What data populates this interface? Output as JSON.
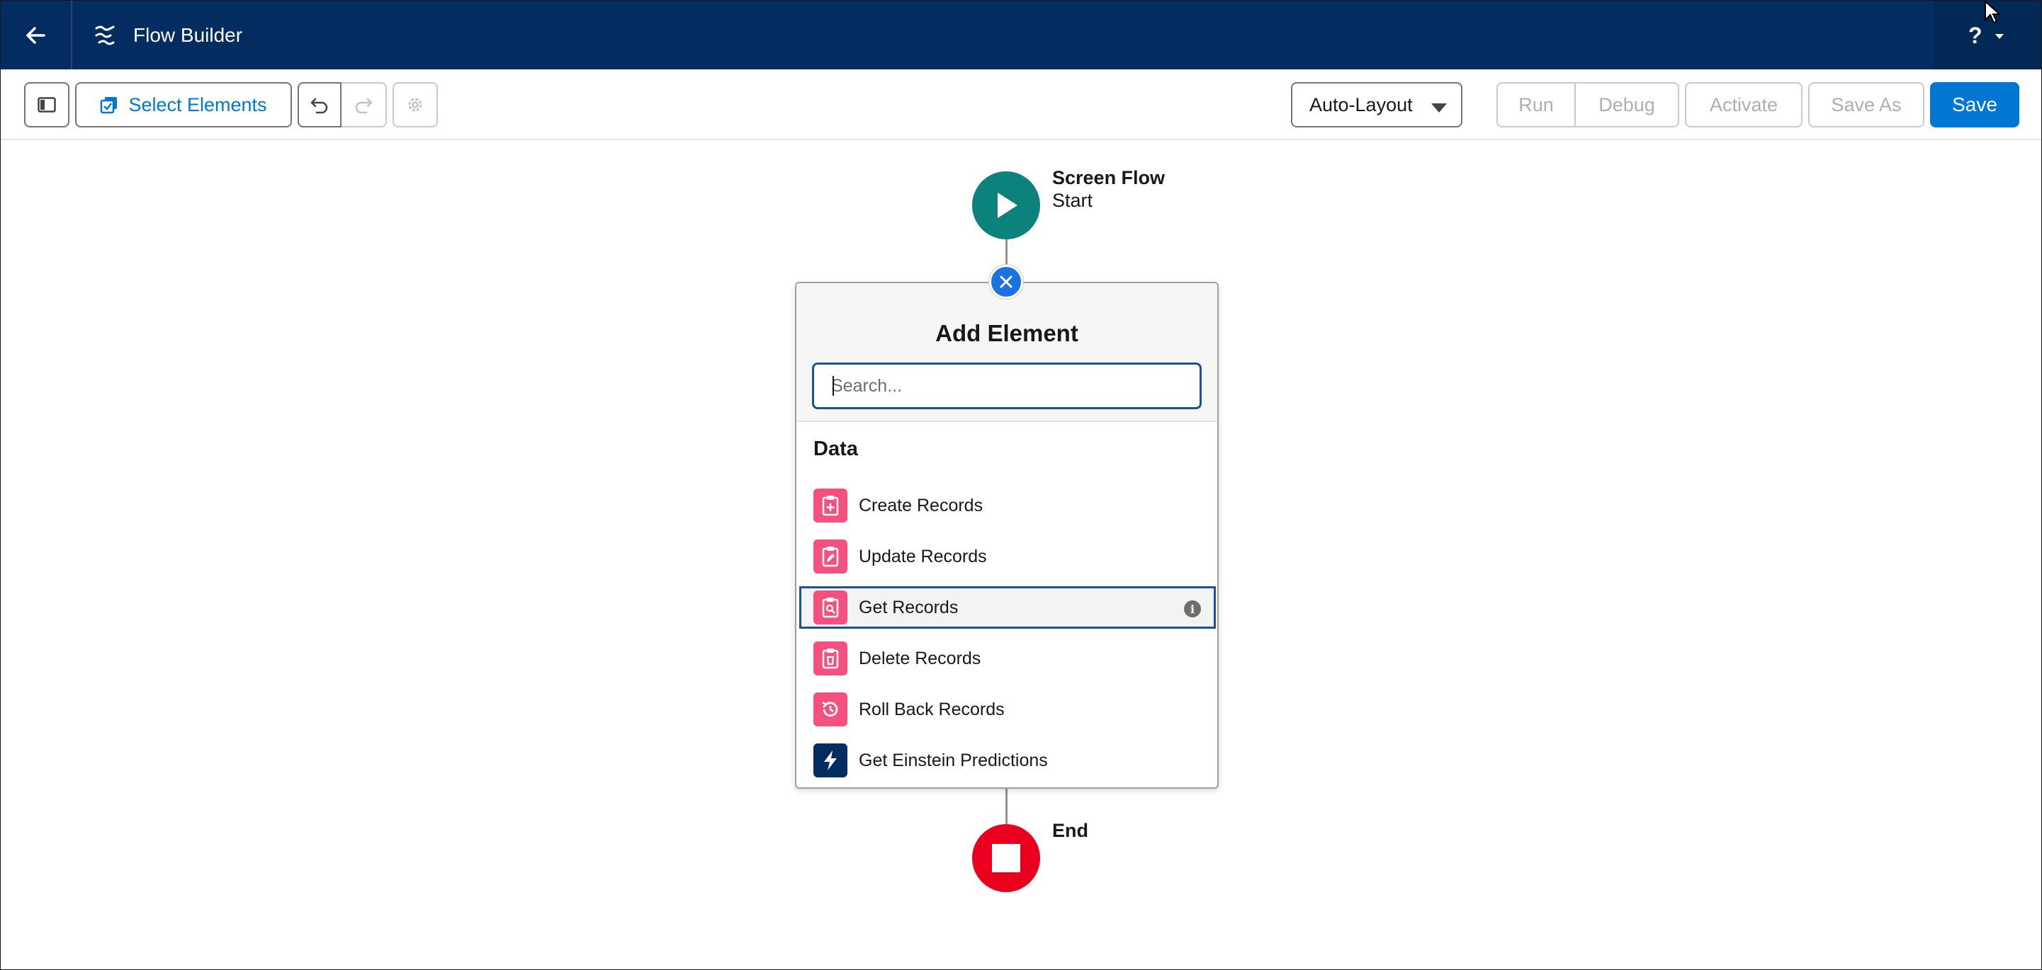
{
  "header": {
    "back_icon": "arrow-left-icon",
    "app_icon": "flow-icon",
    "app_title": "Flow Builder",
    "help_label": "?",
    "brand_color": "#032d60"
  },
  "toolbar": {
    "panel_toggle_icon": "left-panel-icon",
    "select_elements_label": "Select Elements",
    "undo_icon": "undo-icon",
    "redo_icon": "redo-icon",
    "settings_icon": "gear-icon",
    "layout_value": "Auto-Layout",
    "run_label": "Run",
    "debug_label": "Debug",
    "activate_label": "Activate",
    "save_as_label": "Save As",
    "save_label": "Save",
    "accent_color": "#0176d3"
  },
  "canvas": {
    "start": {
      "title": "Screen Flow",
      "subtitle": "Start",
      "color": "#0b827c"
    },
    "end": {
      "title": "End",
      "color": "#ea001e"
    }
  },
  "add_element": {
    "title": "Add Element",
    "search_placeholder": "Search...",
    "section": "Data",
    "items": [
      {
        "label": "Create Records",
        "icon": "create-records-icon",
        "color": "#f4517f",
        "selected": false
      },
      {
        "label": "Update Records",
        "icon": "update-records-icon",
        "color": "#f4517f",
        "selected": false
      },
      {
        "label": "Get Records",
        "icon": "get-records-icon",
        "color": "#f4517f",
        "selected": true
      },
      {
        "label": "Delete Records",
        "icon": "delete-records-icon",
        "color": "#f4517f",
        "selected": false
      },
      {
        "label": "Roll Back Records",
        "icon": "roll-back-records-icon",
        "color": "#f4517f",
        "selected": false
      },
      {
        "label": "Get Einstein Predictions",
        "icon": "lightning-icon",
        "color": "#032d60",
        "selected": false
      }
    ]
  }
}
